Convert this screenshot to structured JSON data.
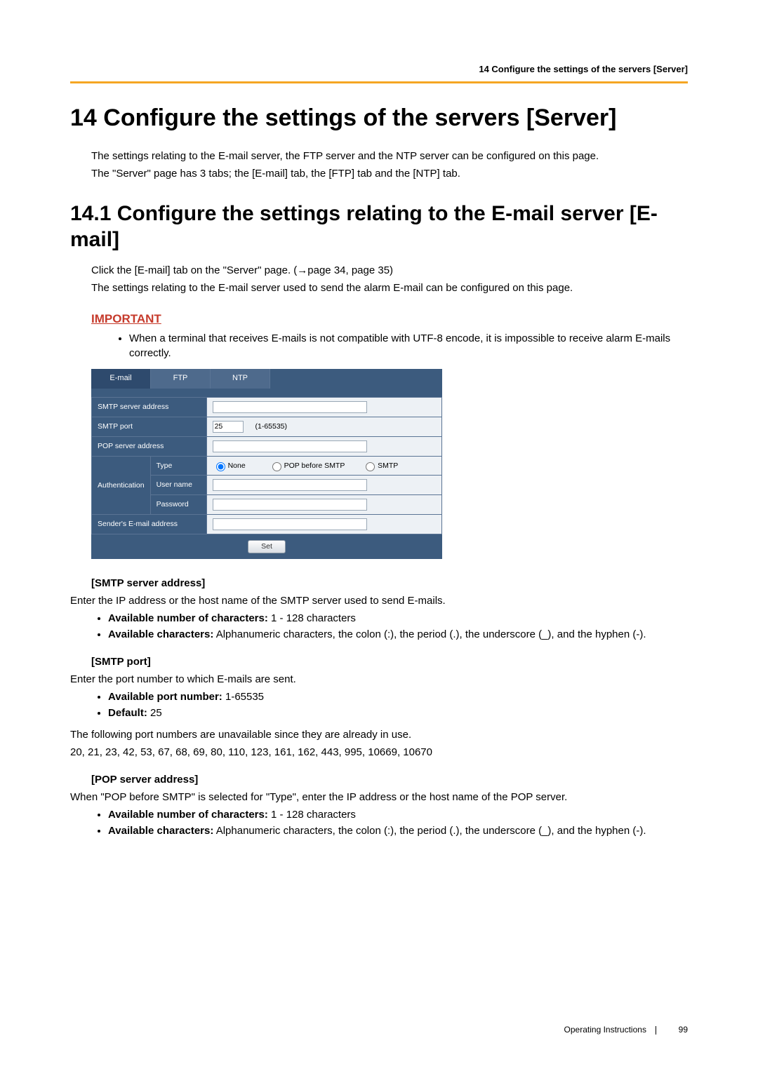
{
  "header": {
    "running_head": "14 Configure the settings of the servers [Server]"
  },
  "chapter": {
    "title": "14   Configure the settings of the servers [Server]",
    "intro1": "The settings relating to the E-mail server, the FTP server and the NTP server can be configured on this page.",
    "intro2": "The \"Server\" page has 3 tabs; the [E-mail] tab, the [FTP] tab and the [NTP] tab."
  },
  "section": {
    "title": "14.1  Configure the settings relating to the E-mail server [E-mail]",
    "click_line": "Click the [E-mail] tab on the \"Server\" page. (→page 34, page 35)",
    "desc_line": "The settings relating to the E-mail server used to send the alarm E-mail can be configured on this page.",
    "important_label": "IMPORTANT",
    "important_item": "When a terminal that receives E-mails is not compatible with UTF-8 encode, it is impossible to receive alarm E-mails correctly."
  },
  "config": {
    "tabs": {
      "email": "E-mail",
      "ftp": "FTP",
      "ntp": "NTP"
    },
    "rows": {
      "smtp_addr": "SMTP server address",
      "smtp_port": "SMTP port",
      "smtp_port_value": "25",
      "smtp_port_range": "(1-65535)",
      "pop_addr": "POP server address",
      "auth": "Authentication",
      "type": "Type",
      "type_none": "None",
      "type_pop": "POP before SMTP",
      "type_smtp": "SMTP",
      "user": "User name",
      "pass": "Password",
      "sender": "Sender's E-mail address",
      "set": "Set"
    }
  },
  "fields": {
    "smtp_addr": {
      "heading": "[SMTP server address]",
      "desc": "Enter the IP address or the host name of the SMTP server used to send E-mails.",
      "b1_label": "Available number of characters:",
      "b1_rest": " 1 - 128 characters",
      "b2_label": "Available characters:",
      "b2_rest": " Alphanumeric characters, the colon (:), the period (.), the underscore (_), and the hyphen (-)."
    },
    "smtp_port": {
      "heading": "[SMTP port]",
      "desc": "Enter the port number to which E-mails are sent.",
      "b1_label": "Available port number:",
      "b1_rest": " 1-65535",
      "b2_label": "Default:",
      "b2_rest": " 25",
      "followup1": "The following port numbers are unavailable since they are already in use.",
      "followup2": "20, 21, 23, 42, 53, 67, 68, 69, 80, 110, 123, 161, 162, 443, 995, 10669, 10670"
    },
    "pop_addr": {
      "heading": "[POP server address]",
      "desc": "When \"POP before SMTP\" is selected for \"Type\", enter the IP address or the host name of the POP server.",
      "b1_label": "Available number of characters:",
      "b1_rest": " 1 - 128 characters",
      "b2_label": "Available characters:",
      "b2_rest": " Alphanumeric characters, the colon (:), the period (.), the underscore (_), and the hyphen (-)."
    }
  },
  "footer": {
    "label": "Operating Instructions",
    "page": "99"
  }
}
